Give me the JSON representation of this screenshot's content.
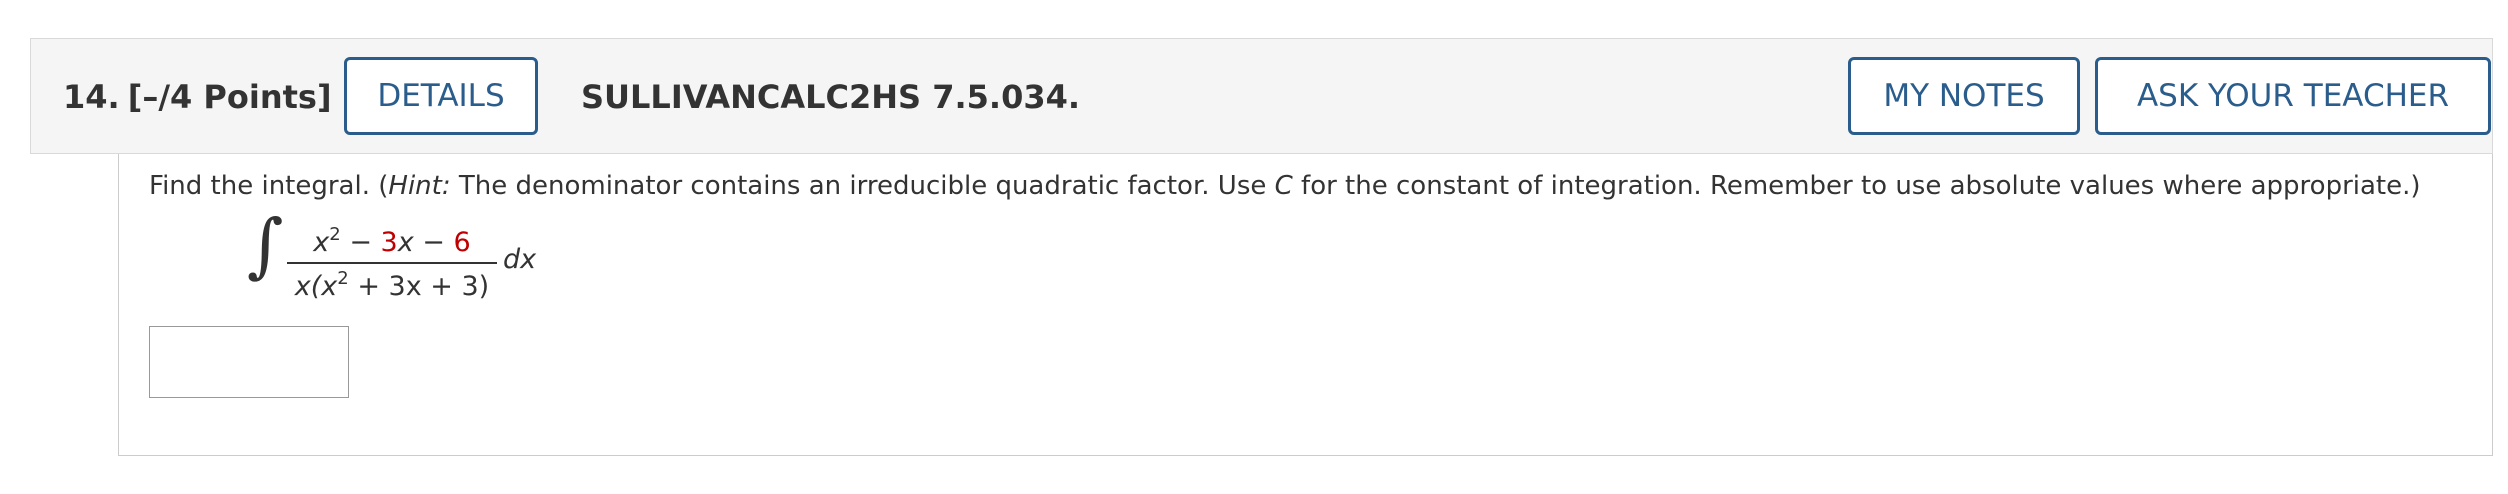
{
  "question": {
    "number": "14.",
    "points": "[–/4 Points]",
    "source": "SULLIVANCALC2HS 7.5.034."
  },
  "buttons": {
    "details": "DETAILS",
    "my_notes": "MY NOTES",
    "ask_teacher": "ASK YOUR TEACHER"
  },
  "prompt": {
    "part1": "Find the integral. (",
    "hint_label": "Hint:",
    "part2": " The denominator contains an irreducible quadratic factor. Use ",
    "constant": "C",
    "part3": " for the constant of integration. Remember to use absolute values where appropriate.)"
  },
  "integral": {
    "sign": "∫",
    "numerator": {
      "term1_base": "x",
      "term1_exp": "2",
      "op1": " − ",
      "coef": "3",
      "var": "x",
      "op2": " − ",
      "const": "6"
    },
    "denominator": {
      "left": "x(x",
      "exp": "2",
      "right": " + 3x + 3)"
    },
    "differential": "dx"
  },
  "answer": {
    "value": ""
  },
  "colors": {
    "button_border": "#2b5d8c",
    "highlight_red": "#c00000",
    "header_bg": "#f5f5f5"
  }
}
